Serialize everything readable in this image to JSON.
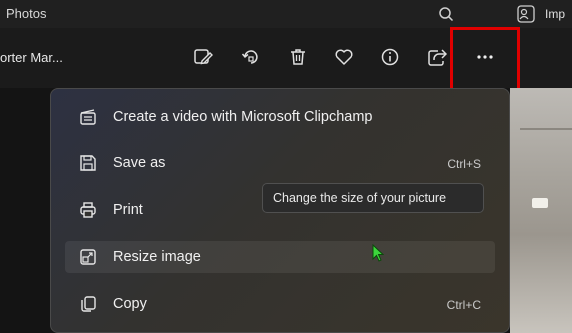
{
  "app": {
    "title": "Photos",
    "import_label": "Imp"
  },
  "toolbar": {
    "file_name": "orter Mar...",
    "buttons": [
      {
        "icon": "edit-image-icon"
      },
      {
        "icon": "rotate-icon"
      },
      {
        "icon": "delete-icon"
      },
      {
        "icon": "favorite-heart-icon"
      },
      {
        "icon": "info-icon"
      },
      {
        "icon": "share-icon"
      },
      {
        "icon": "more-options-icon"
      }
    ],
    "highlight_color": "#e00000"
  },
  "menu": {
    "items": [
      {
        "label": "Create a video with Microsoft Clipchamp",
        "icon": "clipchamp-icon",
        "shortcut": ""
      },
      {
        "label": "Save as",
        "icon": "save-icon",
        "shortcut": "Ctrl+S"
      },
      {
        "label": "Print",
        "icon": "print-icon",
        "shortcut": ""
      },
      {
        "label": "Resize image",
        "icon": "resize-icon",
        "shortcut": ""
      },
      {
        "label": "Copy",
        "icon": "copy-icon",
        "shortcut": "Ctrl+C"
      }
    ]
  },
  "tooltip": {
    "text": "Change the size of your picture"
  }
}
